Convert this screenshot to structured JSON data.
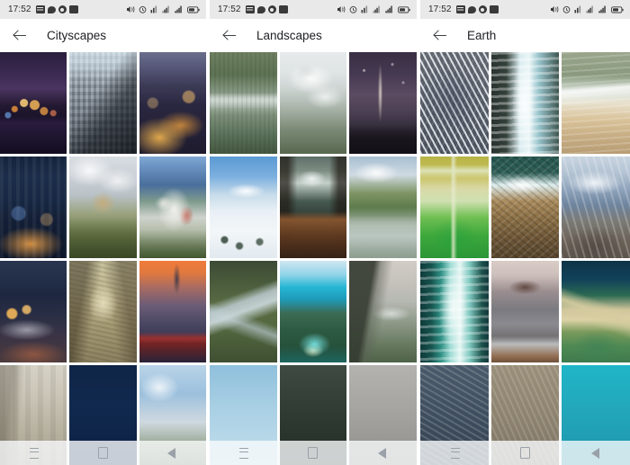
{
  "screens": [
    {
      "id": "cityscapes",
      "status_bar": {
        "clock": "17:52",
        "left_icons": [
          "screenshot-icon",
          "chat-icon",
          "app-update-icon",
          "download-icon"
        ],
        "right_icons": [
          "vibrate-icon",
          "alarm-icon",
          "data-usage-icon",
          "signal-1-icon",
          "signal-2-icon",
          "battery-icon"
        ]
      },
      "toolbar": {
        "back_label": "Back",
        "title": "Cityscapes"
      },
      "grid": {
        "columns": 3,
        "items": [
          {
            "name": "city-skyline-night-purple"
          },
          {
            "name": "manhattan-skyscrapers-daylight"
          },
          {
            "name": "city-highway-lights-dusk"
          },
          {
            "name": "city-blue-hour-towers"
          },
          {
            "name": "hilltop-castle-clouds"
          },
          {
            "name": "neuschwanstein-castle-mountains"
          },
          {
            "name": "snowy-old-town-night"
          },
          {
            "name": "cobblestone-alley-sepia"
          },
          {
            "name": "suspension-bridge-sunset"
          },
          {
            "name": "stone-street-buildings"
          },
          {
            "name": "navy-night-cityscape"
          },
          {
            "name": "mountain-town-blue-sky"
          }
        ]
      },
      "nav_bar": {
        "buttons": [
          "recents-icon",
          "home-icon",
          "back-icon"
        ]
      }
    },
    {
      "id": "landscapes",
      "status_bar": {
        "clock": "17:52",
        "left_icons": [
          "screenshot-icon",
          "chat-icon",
          "app-update-icon",
          "download-icon"
        ],
        "right_icons": [
          "vibrate-icon",
          "alarm-icon",
          "data-usage-icon",
          "signal-1-icon",
          "signal-2-icon",
          "battery-icon"
        ]
      },
      "toolbar": {
        "back_label": "Back",
        "title": "Landscapes"
      },
      "grid": {
        "columns": 3,
        "items": [
          {
            "name": "misty-forest-lake-reflection"
          },
          {
            "name": "cloudy-mountain-peak-fog"
          },
          {
            "name": "starry-night-milky-way"
          },
          {
            "name": "snow-field-pine-trees"
          },
          {
            "name": "wooden-boat-alpine-lake"
          },
          {
            "name": "green-valley-lake-clouds"
          },
          {
            "name": "braided-river-green-canyon"
          },
          {
            "name": "turquoise-lagoon-aerial"
          },
          {
            "name": "basalt-cliff-plateau"
          },
          {
            "name": "pale-blue-sky-scene"
          },
          {
            "name": "dark-forest-ridge"
          },
          {
            "name": "grey-mountain-slope"
          }
        ]
      },
      "nav_bar": {
        "buttons": [
          "recents-icon",
          "home-icon",
          "back-icon"
        ]
      }
    },
    {
      "id": "earth",
      "status_bar": {
        "clock": "17:52",
        "left_icons": [
          "screenshot-icon",
          "chat-icon",
          "app-update-icon",
          "download-icon"
        ],
        "right_icons": [
          "vibrate-icon",
          "alarm-icon",
          "data-usage-icon",
          "signal-1-icon",
          "signal-2-icon",
          "battery-icon"
        ]
      },
      "toolbar": {
        "back_label": "Back",
        "title": "Earth"
      },
      "grid": {
        "columns": 3,
        "items": [
          {
            "name": "aerial-dendritic-riverbed"
          },
          {
            "name": "aerial-surf-breaking-coast"
          },
          {
            "name": "aerial-sandy-beach-shoreline"
          },
          {
            "name": "aerial-algae-green-delta"
          },
          {
            "name": "aerial-rocky-coast-waves"
          },
          {
            "name": "aerial-snowy-mountain-range"
          },
          {
            "name": "aerial-teal-whitewater"
          },
          {
            "name": "coastal-headland-dusk"
          },
          {
            "name": "aerial-sandbar-lagoon"
          },
          {
            "name": "aerial-textured-terrain"
          },
          {
            "name": "aerial-desert-pattern"
          },
          {
            "name": "aerial-turquoise-shallows"
          }
        ]
      },
      "nav_bar": {
        "buttons": [
          "recents-icon",
          "home-icon",
          "back-icon"
        ]
      }
    }
  ],
  "colors": {
    "status_bar_bg": "#e9e9e9",
    "toolbar_bg": "#ffffff",
    "title_text": "#202124",
    "nav_icon": "#9aa1a8",
    "page_bg": "#ffffff"
  }
}
